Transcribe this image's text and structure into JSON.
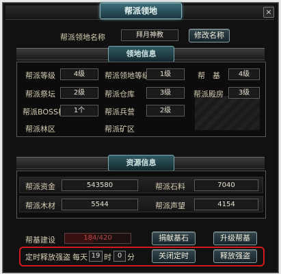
{
  "window": {
    "title": "帮派领地",
    "close_icon": "close-icon"
  },
  "territory_name": {
    "label": "帮派领地名称",
    "value": "拜月神教",
    "rename_button": "修改名称"
  },
  "territory_info": {
    "section_title": "领地信息",
    "fields": {
      "guild_level": {
        "label": "帮派等级",
        "value": "4级"
      },
      "territory_level": {
        "label": "帮派领地等级",
        "value": "1级"
      },
      "base": {
        "label": "帮　基",
        "value": "4级"
      },
      "altar": {
        "label": "帮派祭坛",
        "value": "2级"
      },
      "warehouse": {
        "label": "帮派仓库",
        "value": "3级"
      },
      "hall": {
        "label": "帮派殿房",
        "value": "3级"
      },
      "boss_slot": {
        "label": "帮派BOSS栏",
        "value": "1个"
      },
      "barracks": {
        "label": "帮派兵营",
        "value": "2级"
      },
      "forest": {
        "label": "帮派林区",
        "value": ""
      },
      "mine": {
        "label": "帮派矿区",
        "value": ""
      }
    }
  },
  "resource_info": {
    "section_title": "资源信息",
    "fields": {
      "funds": {
        "label": "帮派资金",
        "value": "543580"
      },
      "stone": {
        "label": "帮派石料",
        "value": "7040"
      },
      "wood": {
        "label": "帮派木材",
        "value": "5544"
      },
      "reputation": {
        "label": "帮派声望",
        "value": "4154"
      }
    }
  },
  "construction": {
    "label": "帮基建设",
    "progress_text": "184/420",
    "progress_fraction": 0.438,
    "donate_button": "捐献基石",
    "upgrade_button": "升级帮基"
  },
  "timer": {
    "label": "定时释放强盗",
    "daily_label": "每天",
    "hour_value": "19",
    "hour_unit": "时",
    "minute_value": "0",
    "minute_unit": "分",
    "close_button": "关闭定时",
    "release_button": "释放强盗"
  },
  "colors": {
    "accent": "#8ab4b9",
    "highlight": "#d41a1a",
    "progress": "#b84848"
  }
}
